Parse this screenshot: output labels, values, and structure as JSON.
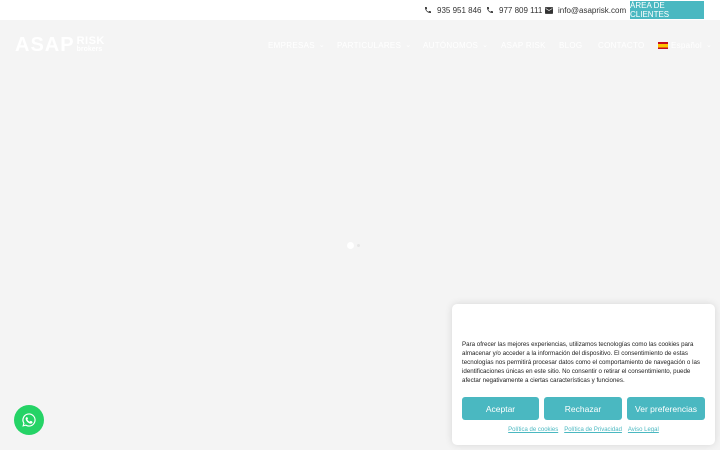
{
  "topbar": {
    "phone1": "935 951 846",
    "phone2": "977 809 111",
    "email": "info@asaprisk.com",
    "client_area": "ÁREA DE CLIENTES"
  },
  "logo": {
    "main": "ASAP",
    "risk": "RISK",
    "sub": "brokers"
  },
  "nav": {
    "items": [
      "EMPRESAS",
      "PARTICULARES",
      "AUTÓNOMOS",
      "ASAP RISK",
      "BLOG",
      "CONTACTO"
    ],
    "language": "Español"
  },
  "cookie": {
    "text": "Para ofrecer las mejores experiencias, utilizamos tecnologías como las cookies para almacenar y/o acceder a la información del dispositivo. El consentimiento de estas tecnologías nos permitirá procesar datos como el comportamiento de navegación o las identificaciones únicas en este sitio. No consentir o retirar el consentimiento, puede afectar negativamente a ciertas características y funciones.",
    "accept": "Aceptar",
    "reject": "Rechazar",
    "preferences": "Ver preferencias",
    "links": [
      "Política de cookies",
      "Política de Privacidad",
      "Aviso Legal"
    ]
  },
  "colors": {
    "accent": "#4ab8c1",
    "whatsapp": "#25d366",
    "background": "#f4f4f4"
  },
  "icons": {
    "phone": "phone-icon",
    "mail": "mail-icon",
    "whatsapp": "whatsapp-icon",
    "chevron": "chevron-down-icon"
  }
}
